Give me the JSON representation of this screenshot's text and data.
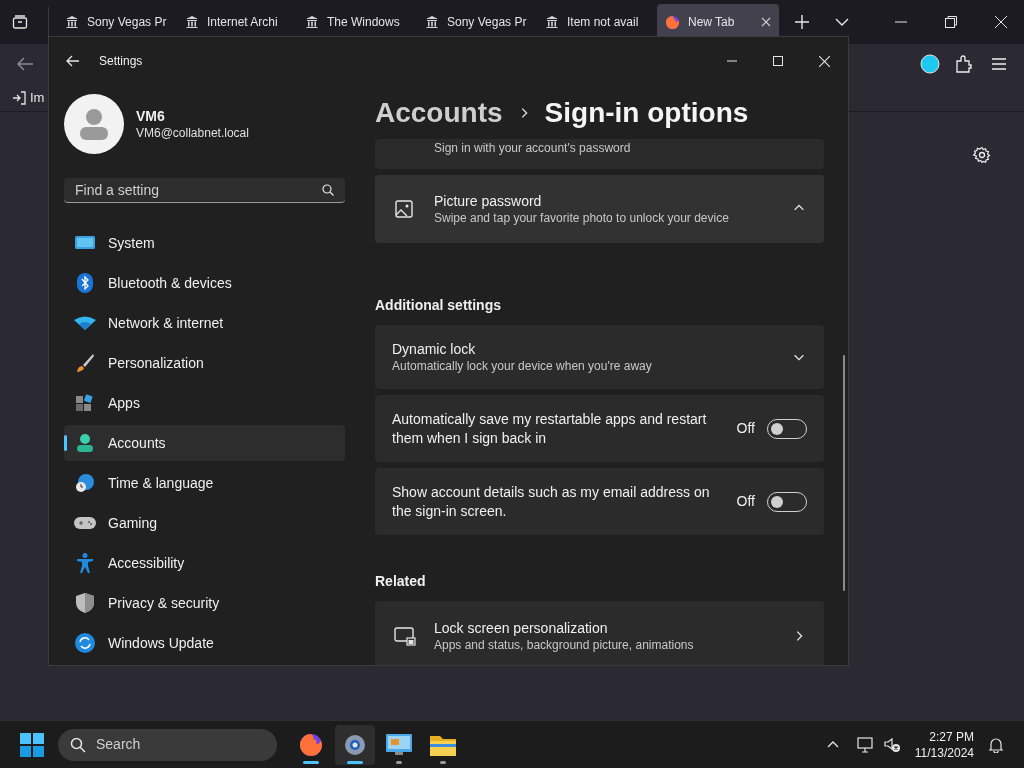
{
  "browser": {
    "tabs": [
      {
        "label": "Sony Vegas Pr",
        "selected": false
      },
      {
        "label": "Internet Archi",
        "selected": false
      },
      {
        "label": "The Windows",
        "selected": false
      },
      {
        "label": "Sony Vegas Pr",
        "selected": false
      },
      {
        "label": "Item not avail",
        "selected": false
      },
      {
        "label": "New Tab",
        "selected": true
      }
    ],
    "bookmark": "Im"
  },
  "settings": {
    "title": "Settings",
    "user": {
      "name": "VM6",
      "email": "VM6@collabnet.local"
    },
    "search": {
      "placeholder": "Find a setting"
    },
    "nav": [
      {
        "label": "System",
        "selected": false
      },
      {
        "label": "Bluetooth & devices",
        "selected": false
      },
      {
        "label": "Network & internet",
        "selected": false
      },
      {
        "label": "Personalization",
        "selected": false
      },
      {
        "label": "Apps",
        "selected": false
      },
      {
        "label": "Accounts",
        "selected": true
      },
      {
        "label": "Time & language",
        "selected": false
      },
      {
        "label": "Gaming",
        "selected": false
      },
      {
        "label": "Accessibility",
        "selected": false
      },
      {
        "label": "Privacy & security",
        "selected": false
      },
      {
        "label": "Windows Update",
        "selected": false
      }
    ],
    "breadcrumb": {
      "parent": "Accounts",
      "current": "Sign-in options"
    },
    "sections": [
      {
        "cards": [
          {
            "kind": "partial",
            "subtitle": "Sign in with your account's password"
          },
          {
            "kind": "expander",
            "title": "Picture password",
            "subtitle": "Swipe and tap your favorite photo to unlock your device",
            "expanded": true
          }
        ]
      },
      {
        "heading": "Additional settings",
        "cards": [
          {
            "kind": "expander",
            "title": "Dynamic lock",
            "subtitle": "Automatically lock your device when you're away",
            "expanded": false
          },
          {
            "kind": "toggle",
            "title": "Automatically save my restartable apps and restart them when I sign back in",
            "status": "Off",
            "on": false
          },
          {
            "kind": "toggle",
            "title": "Show account details such as my email address on the sign-in screen.",
            "status": "Off",
            "on": false
          }
        ]
      },
      {
        "heading": "Related",
        "cards": [
          {
            "kind": "link",
            "title": "Lock screen personalization",
            "subtitle": "Apps and status, background picture, animations"
          }
        ]
      }
    ]
  },
  "taskbar": {
    "search": {
      "placeholder": "Search"
    },
    "apps": [
      {
        "active": true,
        "focused": false
      },
      {
        "active": true,
        "focused": true
      },
      {
        "active": false,
        "focused": false
      },
      {
        "active": false,
        "focused": false
      }
    ],
    "time": "2:27 PM",
    "date": "11/13/2024"
  }
}
